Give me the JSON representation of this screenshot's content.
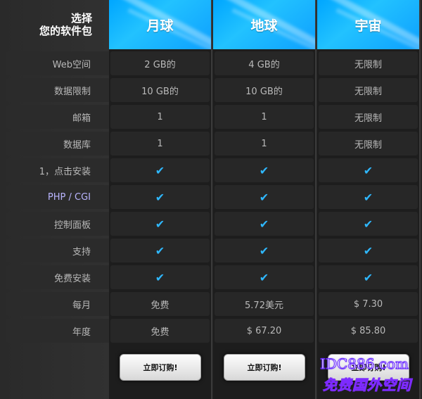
{
  "header": {
    "line1": "选择",
    "line2": "您的软件包"
  },
  "plans": [
    {
      "name": "月球",
      "button": "立即订购!"
    },
    {
      "name": "地球",
      "button": "立即订购!"
    },
    {
      "name": "宇宙",
      "button": "立即订购!"
    }
  ],
  "rows": [
    {
      "label": "Web空间",
      "values": [
        "2 GB的",
        "4 GB的",
        "无限制"
      ]
    },
    {
      "label": "数据限制",
      "values": [
        "10 GB的",
        "10 GB的",
        "无限制"
      ]
    },
    {
      "label": "邮箱",
      "values": [
        "1",
        "1",
        "无限制"
      ]
    },
    {
      "label": "数据库",
      "values": [
        "1",
        "1",
        "无限制"
      ]
    },
    {
      "label": "1，点击安装",
      "values": [
        "✔",
        "✔",
        "✔"
      ]
    },
    {
      "label": "PHP / CGI",
      "values": [
        "✔",
        "✔",
        "✔"
      ]
    },
    {
      "label": "控制面板",
      "values": [
        "✔",
        "✔",
        "✔"
      ]
    },
    {
      "label": "支持",
      "values": [
        "✔",
        "✔",
        "✔"
      ]
    },
    {
      "label": "免费安装",
      "values": [
        "✔",
        "✔",
        "✔"
      ]
    },
    {
      "label": "每月",
      "values": [
        "免费",
        "5.72美元",
        "$ 7.30"
      ]
    },
    {
      "label": "年度",
      "values": [
        "免费",
        "$ 67.20",
        "$ 85.80"
      ]
    }
  ],
  "watermark": {
    "line1": "IDC886.com",
    "line2": "免费国外空间"
  },
  "colors": {
    "accent": "#1eb6ff",
    "check": "#2fb8ff"
  }
}
